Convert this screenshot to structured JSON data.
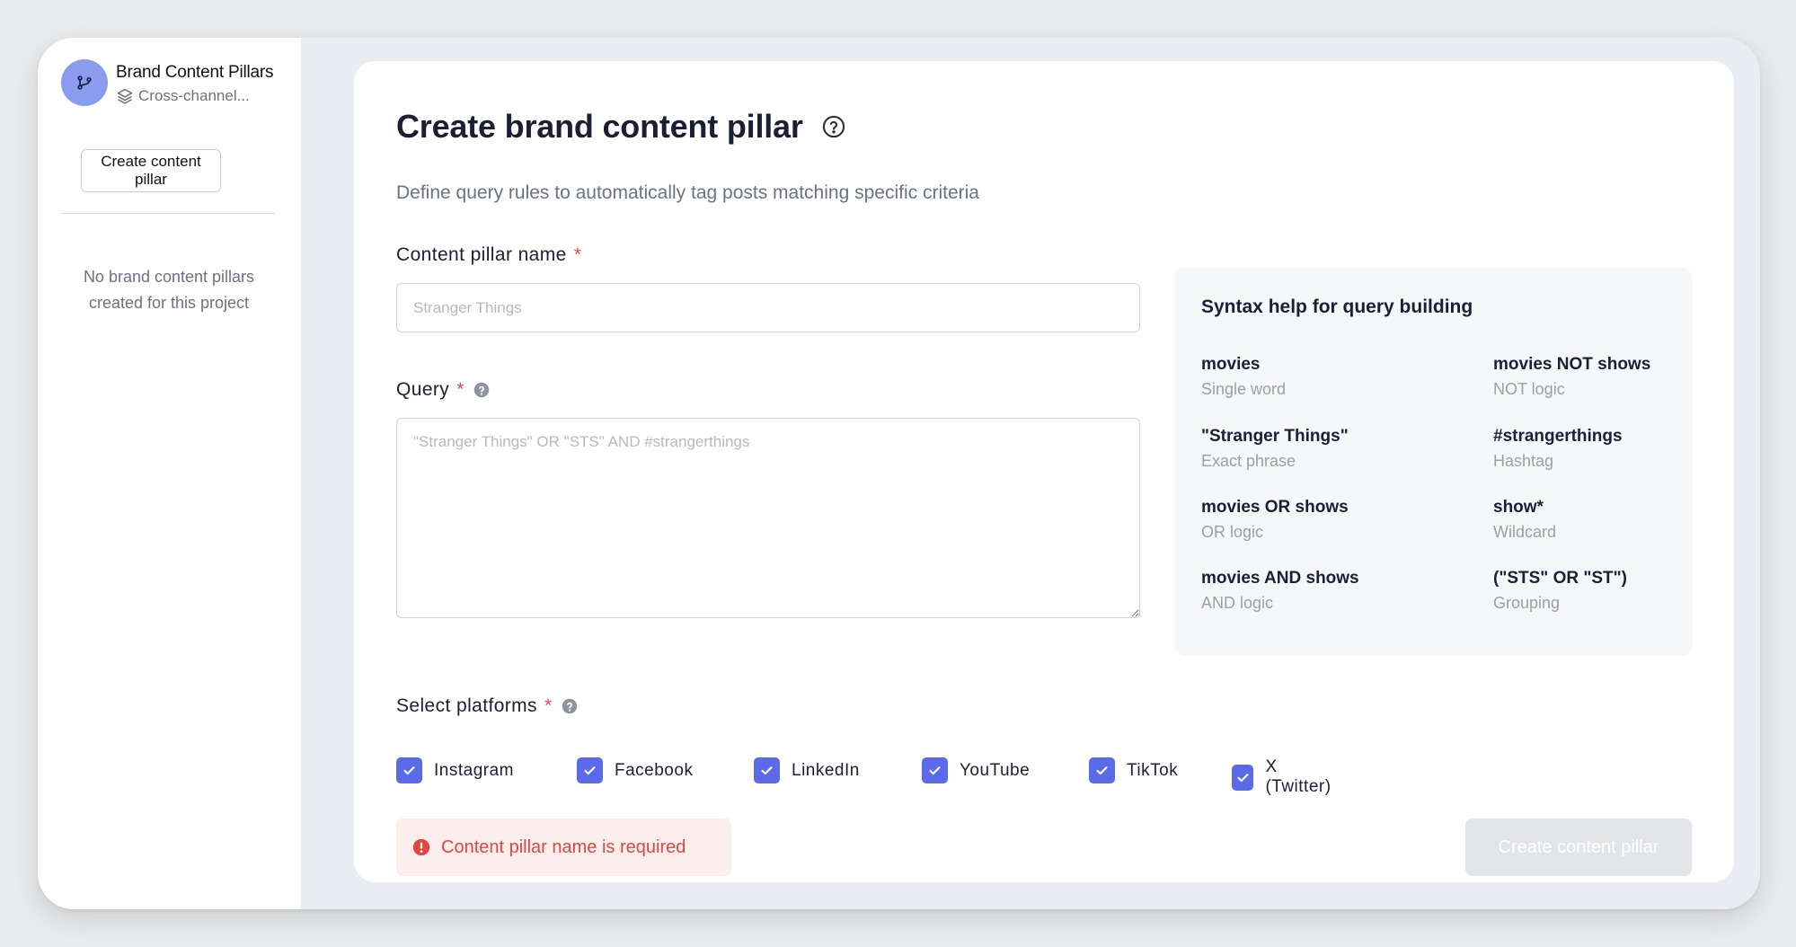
{
  "sidebar": {
    "brand_title": "Brand Content Pillars",
    "brand_subtitle": "Cross-channel...",
    "create_button": "Create content pillar",
    "empty_line1": "No brand content pillars",
    "empty_line2": "created for this project"
  },
  "form": {
    "title": "Create brand content pillar",
    "subtitle": "Define query rules to automatically tag posts matching specific criteria",
    "name_label": "Content pillar name",
    "name_placeholder": "Stranger Things",
    "name_value": "",
    "query_label": "Query",
    "query_placeholder": "\"Stranger Things\" OR \"STS\" AND #strangerthings",
    "platforms_label": "Select platforms",
    "required_mark": "*",
    "platforms": [
      {
        "label": "Instagram",
        "checked": true
      },
      {
        "label": "Facebook",
        "checked": true
      },
      {
        "label": "LinkedIn",
        "checked": true
      },
      {
        "label": "YouTube",
        "checked": true
      },
      {
        "label": "TikTok",
        "checked": true
      },
      {
        "label": "X (Twitter)",
        "checked": true
      }
    ],
    "error_message": "Content pillar name is required",
    "submit_label": "Create content pillar"
  },
  "syntax_help": {
    "title": "Syntax help for query building",
    "items": [
      {
        "code": "movies",
        "desc": "Single word"
      },
      {
        "code": "movies NOT shows",
        "desc": "NOT logic"
      },
      {
        "code": "\"Stranger Things\"",
        "desc": "Exact phrase"
      },
      {
        "code": "#strangerthings",
        "desc": "Hashtag"
      },
      {
        "code": "movies OR shows",
        "desc": "OR logic"
      },
      {
        "code": "show*",
        "desc": "Wildcard"
      },
      {
        "code": "movies AND shows",
        "desc": "AND logic"
      },
      {
        "code": "(\"STS\" OR \"ST\")",
        "desc": "Grouping"
      }
    ]
  },
  "icons": {
    "avatar": "git-branch-icon",
    "subtitle": "layers-icon",
    "title_help": "question-circle-icon",
    "field_help": "question-circle-filled-icon",
    "checkbox": "check-icon",
    "error": "alert-circle-icon"
  },
  "colors": {
    "accent": "#5b6ae8",
    "avatar_bg": "#8b9cef",
    "error": "#e0463f",
    "error_bg": "#fdeeee",
    "required": "#e5484d"
  }
}
